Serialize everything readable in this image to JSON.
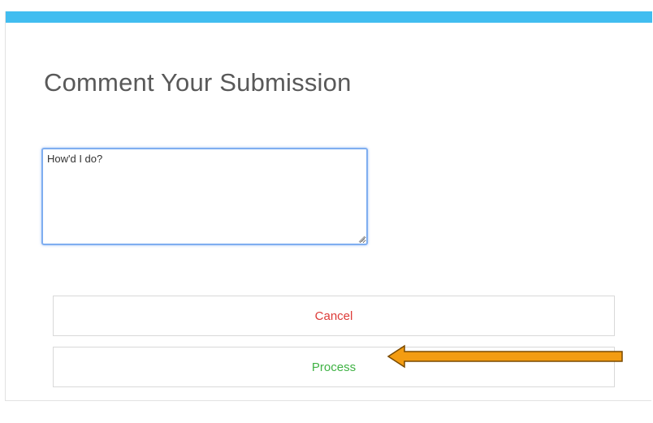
{
  "dialog": {
    "title": "Comment Your Submission",
    "accent_color": "#41bdf0"
  },
  "comment": {
    "value": "How'd I do?"
  },
  "buttons": {
    "cancel_label": "Cancel",
    "cancel_color": "#dd3b38",
    "process_label": "Process",
    "process_color": "#3fb244"
  },
  "annotation": {
    "icon": "left-arrow-icon",
    "color": "#f39c12"
  }
}
